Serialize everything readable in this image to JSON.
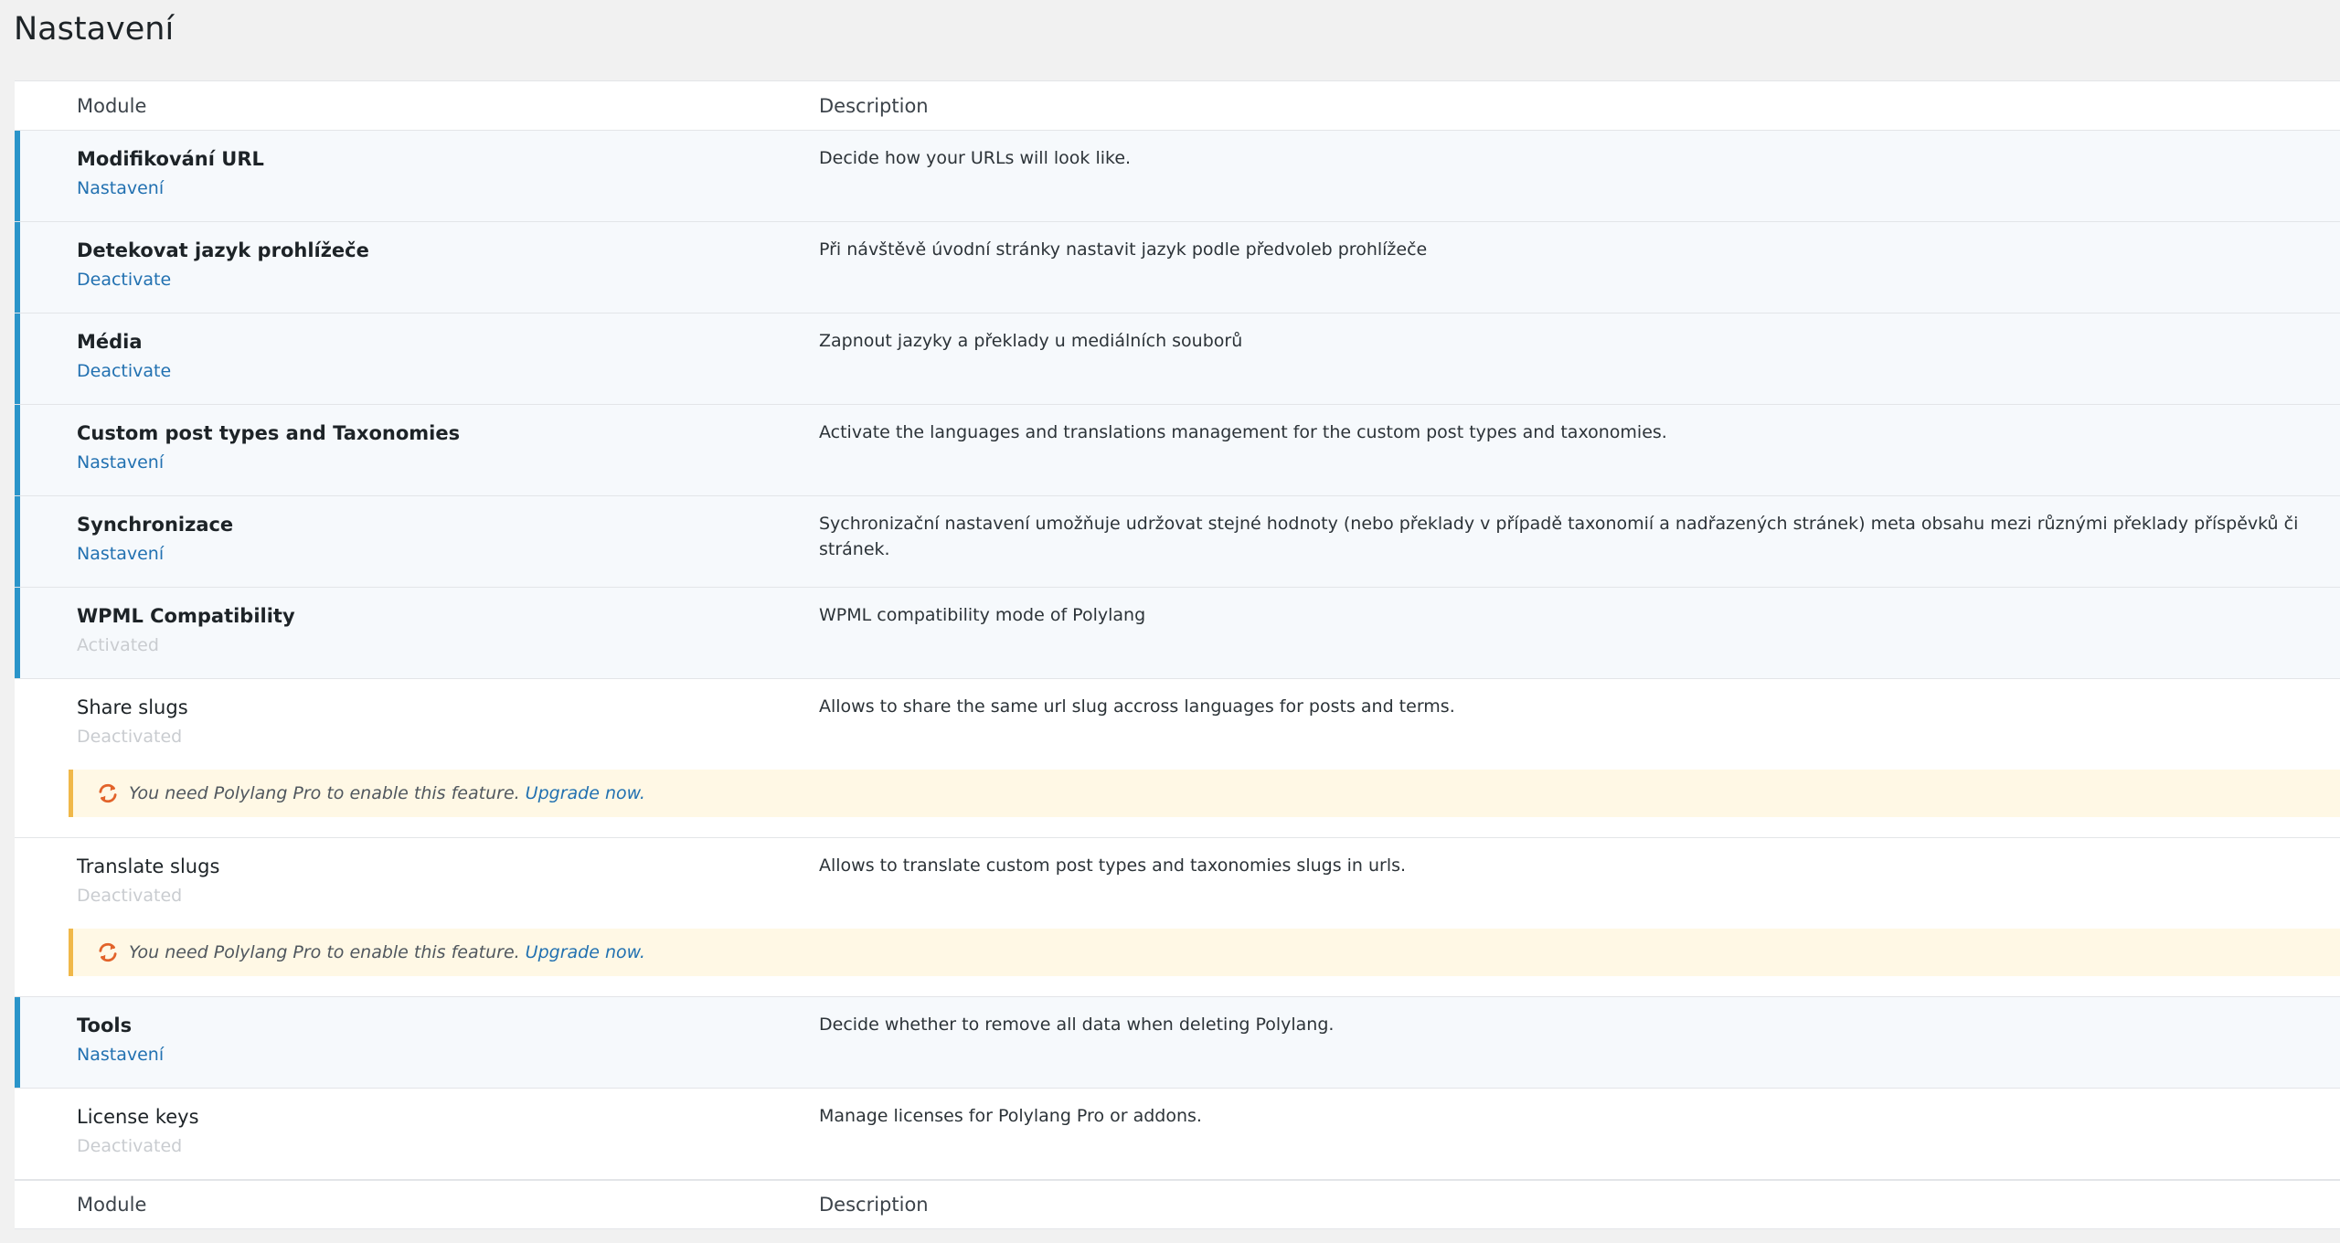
{
  "page": {
    "title": "Nastavení"
  },
  "table": {
    "header": {
      "module": "Module",
      "description": "Description"
    },
    "footer": {
      "module": "Module",
      "description": "Description"
    },
    "rows": [
      {
        "name": "Modifikování URL",
        "action": "Nastavení",
        "description": "Decide how your URLs will look like."
      },
      {
        "name": "Detekovat jazyk prohlížeče",
        "action": "Deactivate",
        "description": "Při návštěvě úvodní stránky nastavit jazyk podle předvoleb prohlížeče"
      },
      {
        "name": "Média",
        "action": "Deactivate",
        "description": "Zapnout jazyky a překlady u mediálních souborů"
      },
      {
        "name": "Custom post types and Taxonomies",
        "action": "Nastavení",
        "description": "Activate the languages and translations management for the custom post types and taxonomies."
      },
      {
        "name": "Synchronizace",
        "action": "Nastavení",
        "description": "Sychronizační nastavení umožňuje udržovat stejné hodnoty (nebo překlady v případě taxonomií a nadřazených stránek) meta obsahu mezi různými překlady příspěvků či stránek."
      },
      {
        "name": "WPML Compatibility",
        "action": "Activated",
        "description": "WPML compatibility mode of Polylang"
      },
      {
        "name": "Share slugs",
        "action": "Deactivated",
        "description": "Allows to share the same url slug accross languages for posts and terms.",
        "notice": "You need Polylang Pro to enable this feature.",
        "notice_link": "Upgrade now."
      },
      {
        "name": "Translate slugs",
        "action": "Deactivated",
        "description": "Allows to translate custom post types and taxonomies slugs in urls.",
        "notice": "You need Polylang Pro to enable this feature.",
        "notice_link": "Upgrade now."
      },
      {
        "name": "Tools",
        "action": "Nastavení",
        "description": "Decide whether to remove all data when deleting Polylang."
      },
      {
        "name": "License keys",
        "action": "Deactivated",
        "description": "Manage licenses for Polylang Pro or addons."
      }
    ]
  },
  "icons": {
    "notice_icon": "sync-icon"
  },
  "colors": {
    "accent": "#2a94c9",
    "link": "#2271b1",
    "notice_bg": "#fff8e5",
    "notice_border": "#f0b849",
    "icon_orange": "#e2632a"
  }
}
